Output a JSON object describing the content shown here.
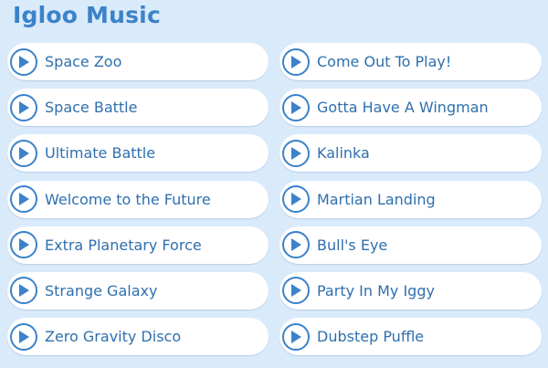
{
  "title": "Igloo Music",
  "tracks": [
    {
      "label": "Space Zoo"
    },
    {
      "label": "Come Out To Play!"
    },
    {
      "label": "Space Battle"
    },
    {
      "label": "Gotta Have A Wingman"
    },
    {
      "label": "Ultimate Battle"
    },
    {
      "label": "Kalinka"
    },
    {
      "label": "Welcome to the Future"
    },
    {
      "label": "Martian Landing"
    },
    {
      "label": "Extra Planetary Force"
    },
    {
      "label": "Bull's Eye"
    },
    {
      "label": "Strange Galaxy"
    },
    {
      "label": "Party In My Iggy"
    },
    {
      "label": "Zero Gravity Disco"
    },
    {
      "label": "Dubstep Puffle"
    }
  ],
  "colors": {
    "background": "#d9eafb",
    "accent": "#3b82c9",
    "text": "#2f6fae",
    "button_bg": "#ffffff"
  },
  "icons": {
    "play": "play-icon"
  }
}
